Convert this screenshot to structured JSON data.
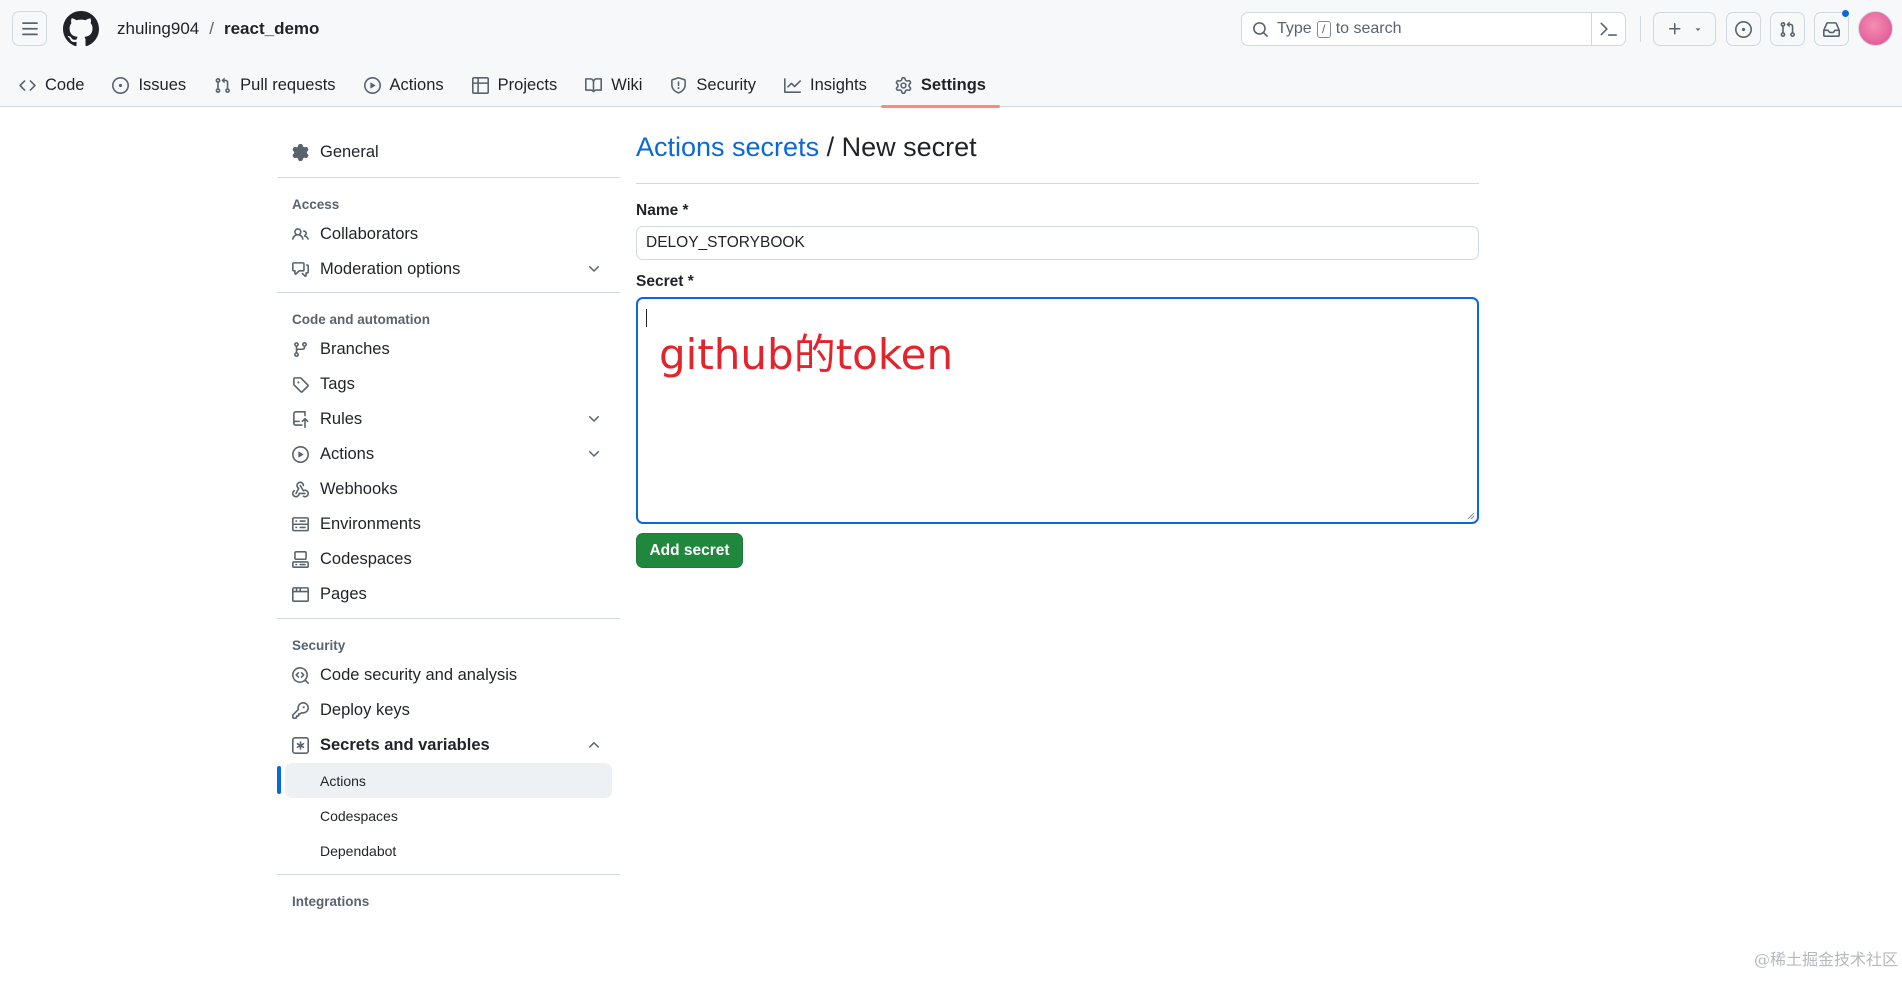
{
  "header": {
    "owner": "zhuling904",
    "separator": "/",
    "repo": "react_demo",
    "search": {
      "prefix": "Type",
      "key": "/",
      "suffix": "to search"
    }
  },
  "tabs": [
    {
      "label": "Code",
      "icon": "code-icon"
    },
    {
      "label": "Issues",
      "icon": "issue-icon"
    },
    {
      "label": "Pull requests",
      "icon": "pull-request-icon"
    },
    {
      "label": "Actions",
      "icon": "play-icon"
    },
    {
      "label": "Projects",
      "icon": "table-icon"
    },
    {
      "label": "Wiki",
      "icon": "book-icon"
    },
    {
      "label": "Security",
      "icon": "shield-icon"
    },
    {
      "label": "Insights",
      "icon": "graph-icon"
    },
    {
      "label": "Settings",
      "icon": "gear-icon",
      "selected": true
    }
  ],
  "sidebar": {
    "general": "General",
    "access": {
      "heading": "Access",
      "items": [
        "Collaborators",
        "Moderation options"
      ]
    },
    "code_automation": {
      "heading": "Code and automation",
      "items": [
        "Branches",
        "Tags",
        "Rules",
        "Actions",
        "Webhooks",
        "Environments",
        "Codespaces",
        "Pages"
      ]
    },
    "security": {
      "heading": "Security",
      "items": [
        "Code security and analysis",
        "Deploy keys",
        "Secrets and variables"
      ],
      "sub_items": [
        "Actions",
        "Codespaces",
        "Dependabot"
      ],
      "active_sub": "Actions"
    },
    "integrations": {
      "heading": "Integrations"
    }
  },
  "main": {
    "breadcrumb_link": "Actions secrets",
    "breadcrumb_sep": "/",
    "page_title": "New secret",
    "name_label": "Name *",
    "name_value": "DELOY_STORYBOOK",
    "secret_label": "Secret *",
    "secret_overlay": "github的token",
    "submit_label": "Add secret"
  },
  "watermark": "@稀土掘金技术社区",
  "colors": {
    "accent": "#0969da",
    "primary_button": "#1f883d",
    "selected_tab_underline": "#fd8c73",
    "overlay_text": "#e3242b"
  }
}
